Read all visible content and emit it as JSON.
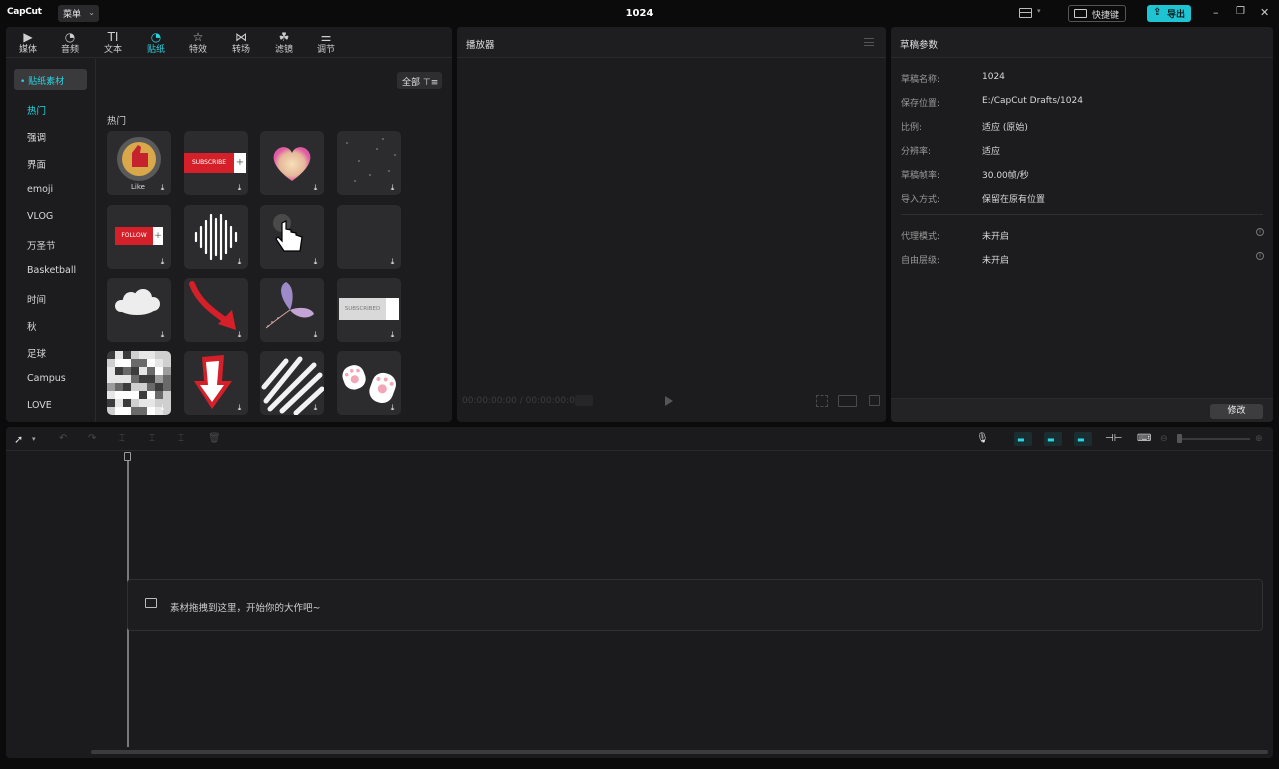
{
  "app": {
    "logo": "CapCut",
    "menu_label": "菜单",
    "project_title": "1024",
    "shortcut_label": "快捷键",
    "export_label": "导出"
  },
  "media": {
    "tabs": [
      {
        "label": "媒体",
        "icon": "media-icon"
      },
      {
        "label": "音频",
        "icon": "audio-icon"
      },
      {
        "label": "文本",
        "icon": "text-icon"
      },
      {
        "label": "贴纸",
        "icon": "sticker-icon"
      },
      {
        "label": "特效",
        "icon": "effects-icon"
      },
      {
        "label": "转场",
        "icon": "transition-icon"
      },
      {
        "label": "滤镜",
        "icon": "filter-icon"
      },
      {
        "label": "调节",
        "icon": "adjust-icon"
      }
    ],
    "active_tab": "贴纸",
    "category_header": "• 贴纸素材",
    "categories": [
      "热门",
      "强调",
      "界面",
      "emoji",
      "VLOG",
      "万圣节",
      "Basketball",
      "时间",
      "秋",
      "足球",
      "Campus",
      "LOVE"
    ],
    "filter_label": "全部",
    "section_label": "热门",
    "sticker_texts": {
      "like": "Like",
      "subscribe": "SUBSCRIBE",
      "follow": "FOLLOW",
      "subscribed": "SUBSCRIBED",
      "plus": "+"
    }
  },
  "player": {
    "title": "播放器",
    "timecode": "00:00:00:00 / 00:00:00:00"
  },
  "props": {
    "title": "草稿参数",
    "rows": [
      {
        "label": "草稿名称:",
        "value": "1024"
      },
      {
        "label": "保存位置:",
        "value": "E:/CapCut Drafts/1024"
      },
      {
        "label": "比例:",
        "value": "适应 (原始)"
      },
      {
        "label": "分辨率:",
        "value": "适应"
      },
      {
        "label": "草稿帧率:",
        "value": "30.00帧/秒"
      },
      {
        "label": "导入方式:",
        "value": "保留在原有位置"
      }
    ],
    "rows2": [
      {
        "label": "代理模式:",
        "value": "未开启"
      },
      {
        "label": "自由层级:",
        "value": "未开启"
      }
    ],
    "modify_label": "修改"
  },
  "timeline": {
    "drop_hint": "素材拖拽到这里，开始你的大作吧~"
  },
  "colors": {
    "accent": "#1fc4d2",
    "bg": "#0b0b0c",
    "panel": "#1c1c1e",
    "sticker_red": "#d5202a"
  }
}
